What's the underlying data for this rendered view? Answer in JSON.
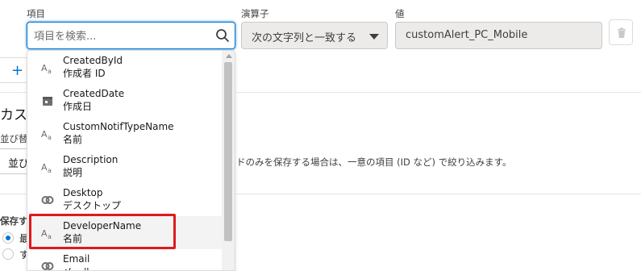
{
  "filter": {
    "field_label": "項目",
    "operator_label": "演算子",
    "value_label": "値",
    "search_placeholder": "項目を検索...",
    "operator_value": "次の文字列と一致する",
    "value": "customAlert_PC_Mobile"
  },
  "background": {
    "add_symbol": "+",
    "section_title": "カスタ",
    "sort_label": "並び替",
    "sort_value": "並び",
    "help_text": "ドのみを保存する場合は、一意の項目 (ID など) で絞り込みます。",
    "save_label": "保存す",
    "radio_options": [
      "最",
      "す"
    ]
  },
  "dropdown": {
    "options": [
      {
        "api": "CreatedById",
        "label": "作成者 ID",
        "icon": "text-type-icon"
      },
      {
        "api": "CreatedDate",
        "label": "作成日",
        "icon": "calendar-icon"
      },
      {
        "api": "CustomNotifTypeName",
        "label": "名前",
        "icon": "text-type-icon"
      },
      {
        "api": "Description",
        "label": "説明",
        "icon": "text-type-icon"
      },
      {
        "api": "Desktop",
        "label": "デスクトップ",
        "icon": "toggle-icon"
      },
      {
        "api": "DeveloperName",
        "label": "名前",
        "icon": "text-type-icon"
      },
      {
        "api": "Email",
        "label": "メール",
        "icon": "toggle-icon"
      }
    ],
    "highlighted_index": 5
  },
  "colors": {
    "accent": "#0176d3",
    "annotation_red": "#e0191f",
    "highlight_bg": "#f3f3f3"
  }
}
